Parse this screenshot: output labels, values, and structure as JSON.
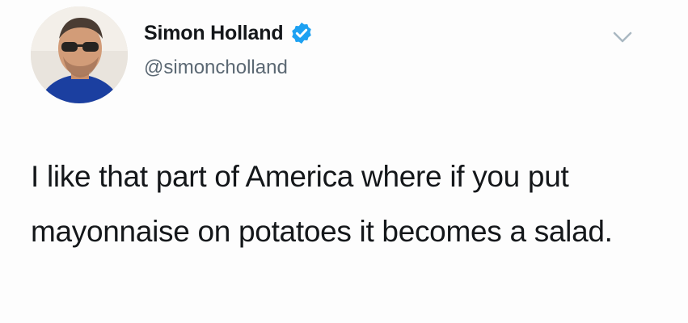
{
  "tweet": {
    "author": {
      "display_name": "Simon Holland",
      "handle": "@simoncholland",
      "verified_icon": "verified-badge-icon",
      "avatar_icon": "user-avatar"
    },
    "menu_icon": "chevron-down-icon",
    "text": "I like that part of America where if you put mayonnaise on potatoes it becomes a salad."
  },
  "colors": {
    "verified": "#1da1f2",
    "text": "#14171a",
    "handle": "#5b6873",
    "caret": "#aab8c2"
  }
}
